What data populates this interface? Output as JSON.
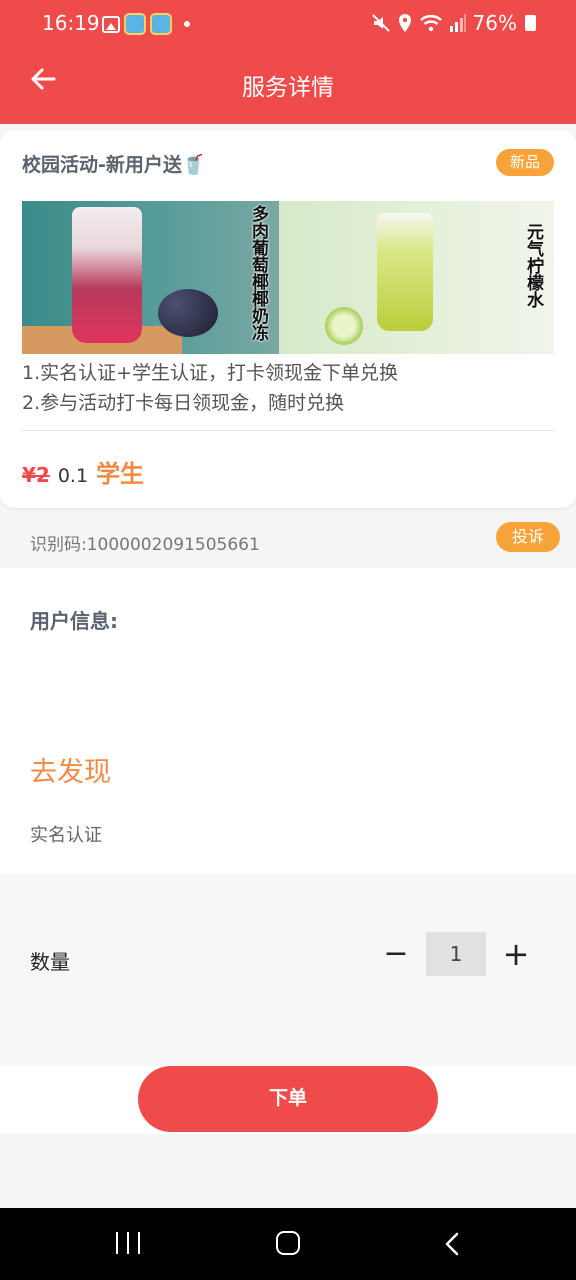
{
  "status_bar": {
    "time": "16:19",
    "battery": "76%",
    "icons": [
      "image-icon",
      "app-icon",
      "app-icon",
      "dot-icon",
      "mute-icon",
      "location-icon",
      "wifi-icon",
      "signal-icon",
      "battery-icon"
    ]
  },
  "header": {
    "title": "服务详情",
    "back_icon": "back-arrow-icon"
  },
  "product": {
    "title": "校园活动-新用户送🥤",
    "badge": "新品",
    "banner_left_text": "多肉葡萄椰椰奶冻",
    "banner_right_text": "元气柠檬水",
    "desc_line1": "1.实名认证+学生认证，打卡领现金下单兑换",
    "desc_line2": "2.参与活动打卡每日领现金，随时兑换",
    "price_old": "¥2",
    "price_new": "0.1",
    "price_tag": "学生"
  },
  "info": {
    "code": "识别码:1000002091505661",
    "complain_label": "投诉"
  },
  "user": {
    "label": "用户信息:",
    "discover": "去发现",
    "auth": "实名认证"
  },
  "quantity": {
    "label": "数量",
    "minus": "−",
    "value": "1",
    "plus": "+"
  },
  "order": {
    "button_label": "下单"
  },
  "colors": {
    "brand_red": "#ef4b4b",
    "badge_orange": "#f7a33a",
    "accent_orange": "#f08a45"
  }
}
